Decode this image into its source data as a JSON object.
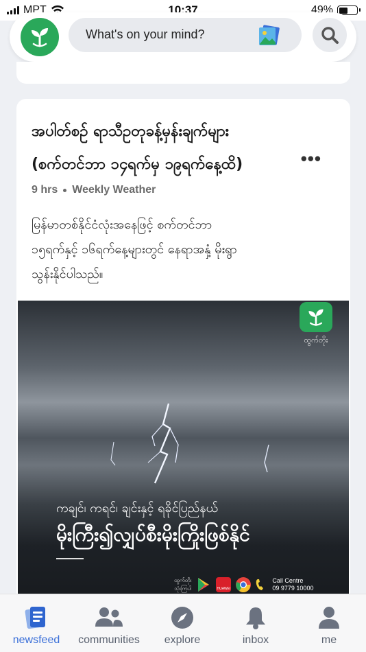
{
  "status_bar": {
    "carrier": "MPT",
    "time": "10:37",
    "battery": "49%"
  },
  "header": {
    "search_placeholder": "What's on your mind?"
  },
  "post": {
    "title_line1": "အပါတ်စဉ် ရာသီဥတုခန့်မှန်းချက်များ",
    "title_line2": "(စက်တင်ဘာ ၁၄ရက်မှ ၁၉ရက်နေ့ထိ)",
    "more_label": "•••",
    "time_ago": "9 hrs",
    "community": "Weekly Weather",
    "body_line1": "မြန်မာတစ်နိုင်ငံလုံးအနေဖြင့် စက်တင်ဘာ",
    "body_line2": "၁၅ရက်နှင့် ၁၆ရက်နေ့များတွင် နေရာအနှံ့ မိုးရွာ",
    "body_line3": "သွန်းနိုင်ပါသည်။",
    "image": {
      "logo_label": "ထွက်တိုး",
      "subtitle": "ကချင်၊ ကရင်၊ ချင်းနှင့် ရခိုင်ပြည်နယ်",
      "headline": "မိုးကြီး၍လျှပ်စီးမိုးကြိုးဖြစ်နိုင်",
      "footer_brand": "ထွက်တိုး",
      "footer_brand_sub": "သုံးကြပါ",
      "huawei_label": "HUAWEI",
      "call_centre_label": "Call Centre",
      "call_centre_number": "09 9779 10000"
    }
  },
  "nav": {
    "items": [
      {
        "label": "newsfeed",
        "icon": "newsfeed-icon"
      },
      {
        "label": "communities",
        "icon": "communities-icon"
      },
      {
        "label": "explore",
        "icon": "compass-icon"
      },
      {
        "label": "inbox",
        "icon": "bell-icon"
      },
      {
        "label": "me",
        "icon": "person-icon"
      }
    ]
  },
  "colors": {
    "brand_green": "#2aa85a",
    "active_blue": "#3a6fd8",
    "inactive_gray": "#5a6270"
  }
}
